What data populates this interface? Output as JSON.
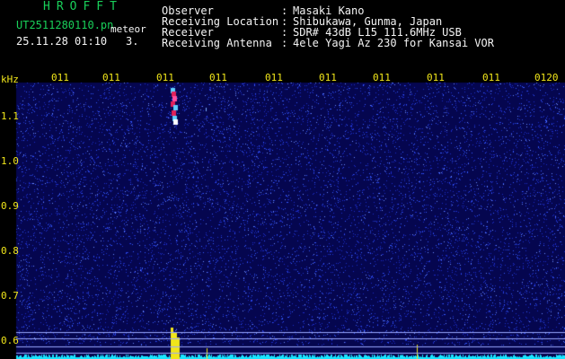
{
  "header": {
    "logo": "HROFFT",
    "filename": "UT2511280110.pn",
    "mode": "meteor",
    "datetime": "25.11.28 01:10",
    "index": "3.",
    "fields": [
      {
        "label": "Observer",
        "sep": ":",
        "value": "Masaki Kano"
      },
      {
        "label": "Receiving Location",
        "sep": ":",
        "value": "Shibukawa, Gunma, Japan"
      },
      {
        "label": "Receiver",
        "sep": ":",
        "value": "SDR# 43dB L15 111.6MHz USB"
      },
      {
        "label": "Receiving Antenna",
        "sep": ":",
        "value": "4ele Yagi Az 230 for Kansai VOR"
      }
    ]
  },
  "spectrogram": {
    "unit": "kHz",
    "time_ticks": [
      "011",
      "011",
      "011",
      "011",
      "011",
      "011",
      "011",
      "011",
      "011",
      "0120"
    ],
    "freq_ticks": [
      "1.1",
      "1.0",
      "0.9",
      "0.8",
      "0.7",
      "0.6"
    ],
    "colors": {
      "background": "#05064f",
      "noise": "#2a44ff",
      "echo": "#e3205a",
      "text": "#f1e61a",
      "power": "#19e6ff"
    }
  }
}
